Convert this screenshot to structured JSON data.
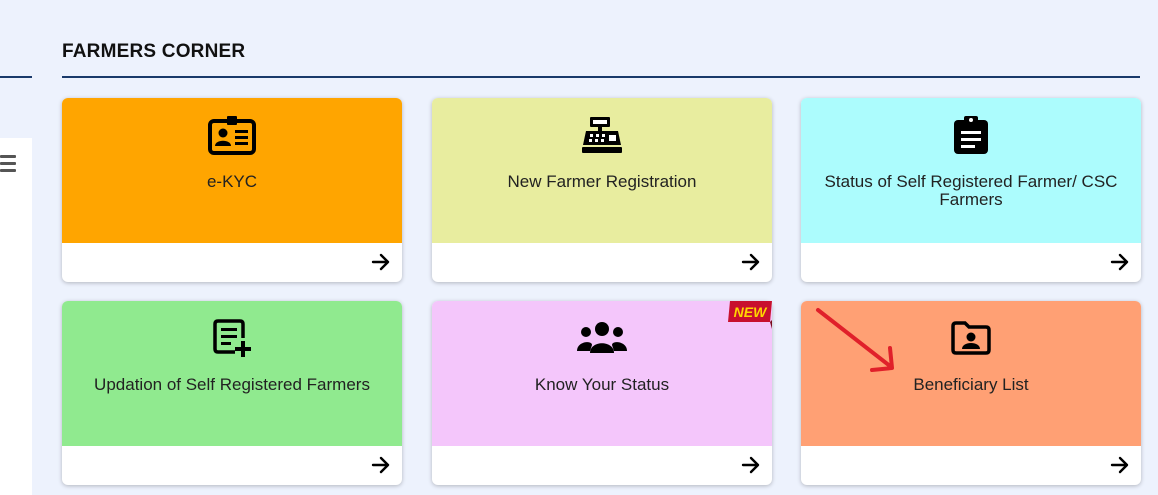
{
  "section": {
    "title": "FARMERS CORNER"
  },
  "colors": {
    "page_background": "#edf2fd",
    "rule": "#1a3a6b",
    "annotation_arrow": "#e0202a"
  },
  "cards": [
    {
      "label": "e-KYC",
      "icon": "id-card-icon",
      "color": "#ffa500"
    },
    {
      "label": "New Farmer Registration",
      "icon": "cash-register-icon",
      "color": "#e8ed9f"
    },
    {
      "label": "Status of Self Registered Farmer/ CSC Farmers",
      "icon": "clipboard-list-icon",
      "color": "#acfcfd"
    },
    {
      "label": "Updation of Self Registered Farmers",
      "icon": "add-list-icon",
      "color": "#90ea8f"
    },
    {
      "label": "Know Your Status",
      "icon": "users-group-icon",
      "color": "#f4c6fb",
      "badge": "NEW"
    },
    {
      "label": "Beneficiary List",
      "icon": "folder-user-icon",
      "color": "#ffa074"
    }
  ]
}
